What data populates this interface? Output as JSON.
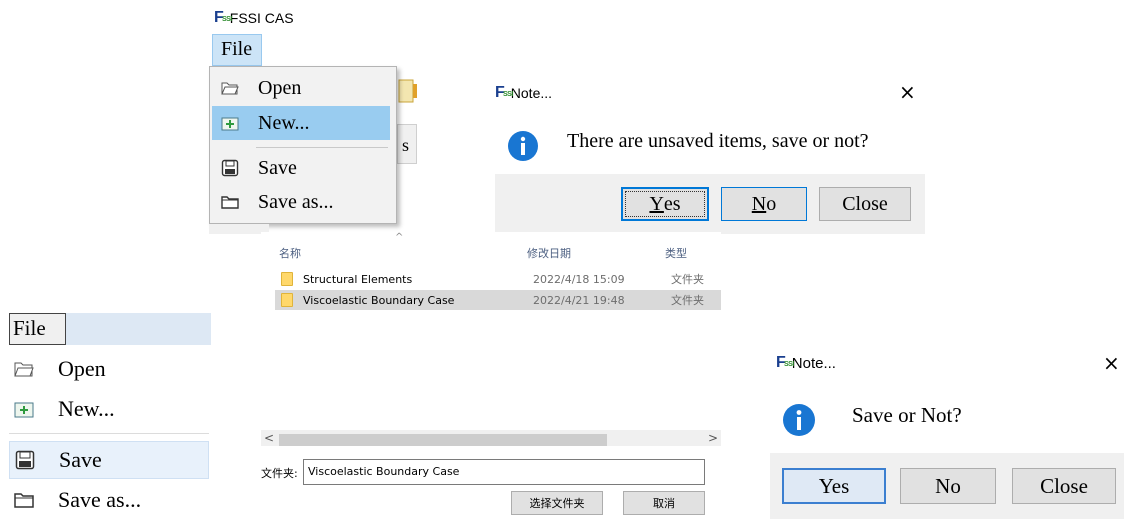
{
  "app": {
    "logo": "F",
    "logo_sub": "SSI",
    "title": "FSSI CAS"
  },
  "menu_small": {
    "file_label": "File",
    "items": [
      {
        "label": "Open",
        "icon": "folder-open-icon"
      },
      {
        "label": "New...",
        "icon": "new-document-icon",
        "highlighted": true
      },
      {
        "label": "Save",
        "icon": "save-disk-icon"
      },
      {
        "label": "Save as...",
        "icon": "save-as-folder-icon"
      }
    ],
    "behind_tab_text": "s"
  },
  "dialog_unsaved": {
    "title": "Note...",
    "close_glyph": "×",
    "message": "There are unsaved items, save or not?",
    "buttons": {
      "yes_prefix": "",
      "yes_ul": "Y",
      "yes_rest": "es",
      "no_ul": "N",
      "no_rest": "o",
      "close": "Close"
    }
  },
  "folder_browser": {
    "columns": {
      "name": "名称",
      "date": "修改日期",
      "type": "类型"
    },
    "sort_glyph": "^",
    "rows": [
      {
        "name": "Structural Elements",
        "date": "2022/4/18 15:09",
        "type": "文件夹",
        "selected": false
      },
      {
        "name": "Viscoelastic Boundary Case",
        "date": "2022/4/21 19:48",
        "type": "文件夹",
        "selected": true
      }
    ],
    "scroll_left": "<",
    "scroll_right": ">",
    "folder_label": "文件夹:",
    "folder_value": "Viscoelastic Boundary Case",
    "select_button": "选择文件夹",
    "cancel_button": "取消"
  },
  "menu_large": {
    "file_label": "File",
    "items": [
      {
        "label": "Open",
        "icon": "folder-open-icon"
      },
      {
        "label": "New...",
        "icon": "new-document-icon"
      },
      {
        "label": "Save",
        "icon": "save-disk-icon",
        "highlighted": true
      },
      {
        "label": "Save as...",
        "icon": "save-as-folder-icon"
      }
    ]
  },
  "dialog_save": {
    "title": "Note...",
    "close_glyph": "×",
    "message": "Save or Not?",
    "buttons": {
      "yes": "Yes",
      "no": "No",
      "close": "Close"
    }
  },
  "colors": {
    "accent": "#0078d7",
    "menu_highlight": "#99ccf0",
    "info_blue": "#1976d2"
  }
}
